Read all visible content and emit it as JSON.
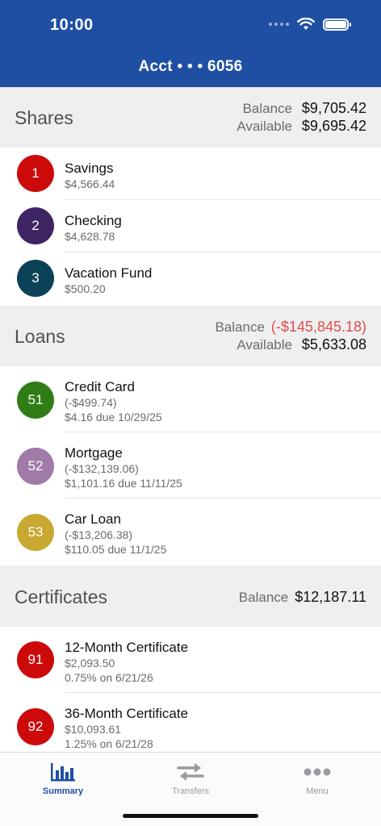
{
  "status": {
    "time": "10:00"
  },
  "header": {
    "title": "Acct  • • •  6056"
  },
  "colors": {
    "brand": "#1f4fa3",
    "negative": "#e14b4b"
  },
  "shares": {
    "title": "Shares",
    "balance_label": "Balance",
    "balance_value": "$9,705.42",
    "available_label": "Available",
    "available_value": "$9,695.42",
    "items": [
      {
        "num": "1",
        "name": "Savings",
        "amount": "$4,566.44",
        "color": "#cc0a0a"
      },
      {
        "num": "2",
        "name": "Checking",
        "amount": "$4,628.78",
        "color": "#3e2462"
      },
      {
        "num": "3",
        "name": "Vacation Fund",
        "amount": "$500.20",
        "color": "#0c4258"
      }
    ]
  },
  "loans": {
    "title": "Loans",
    "balance_label": "Balance",
    "balance_value": "(-$145,845.18)",
    "available_label": "Available",
    "available_value": "$5,633.08",
    "items": [
      {
        "num": "51",
        "name": "Credit Card",
        "amount": "(-$499.74)",
        "due": "$4.16 due 10/29/25",
        "color": "#2f7d14"
      },
      {
        "num": "52",
        "name": "Mortgage",
        "amount": "(-$132,139.06)",
        "due": "$1,101.16 due 11/11/25",
        "color": "#a07aa8"
      },
      {
        "num": "53",
        "name": "Car Loan",
        "amount": "(-$13,206.38)",
        "due": "$110.05 due 11/1/25",
        "color": "#c8a830"
      }
    ]
  },
  "certificates": {
    "title": "Certificates",
    "balance_label": "Balance",
    "balance_value": "$12,187.11",
    "items": [
      {
        "num": "91",
        "name": "12-Month Certificate",
        "amount": "$2,093.50",
        "rate": "0.75% on 6/21/26",
        "color": "#cc0a0a"
      },
      {
        "num": "92",
        "name": "36-Month Certificate",
        "amount": "$10,093.61",
        "rate": "1.25% on 6/21/28",
        "color": "#cc0a0a"
      }
    ]
  },
  "tabs": {
    "summary": {
      "label": "Summary",
      "icon": "bar-chart-icon"
    },
    "transfers": {
      "label": "Transfers",
      "icon": "transfer-arrows-icon"
    },
    "menu": {
      "label": "Menu",
      "icon": "ellipsis-icon"
    }
  }
}
